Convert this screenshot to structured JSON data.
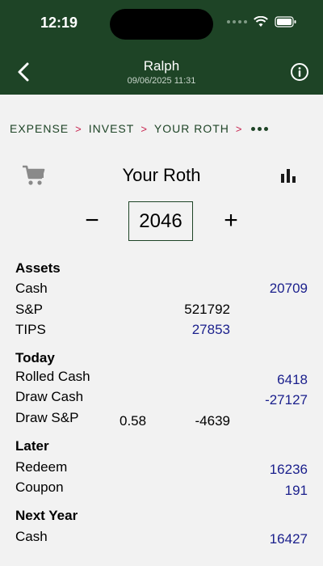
{
  "status_bar": {
    "time": "12:19"
  },
  "header": {
    "name": "Ralph",
    "timestamp": "09/06/2025 11:31"
  },
  "breadcrumb": {
    "items": [
      "EXPENSE",
      "INVEST",
      "YOUR ROTH"
    ],
    "separator": ">"
  },
  "page": {
    "title": "Your Roth",
    "year": "2046",
    "minus_label": "−",
    "plus_label": "+"
  },
  "sections": {
    "assets": {
      "heading": "Assets",
      "cash_label": "Cash",
      "cash_value": "20709",
      "sp_label": "S&P",
      "sp_value": "521792",
      "tips_label": "TIPS",
      "tips_value": "27853"
    },
    "today": {
      "heading": "Today",
      "rolled_label": "Rolled Cash",
      "rolled_value": "6418",
      "draw_cash_label": "Draw Cash",
      "draw_cash_value": "-27127",
      "draw_sp_label": "Draw S&P",
      "draw_sp_rate": "0.58",
      "draw_sp_value": "-4639"
    },
    "later": {
      "heading": "Later",
      "redeem_label": "Redeem",
      "redeem_value": "16236",
      "coupon_label": "Coupon",
      "coupon_value": "191"
    },
    "next_year": {
      "heading": "Next Year",
      "cash_label": "Cash",
      "cash_value": "16427"
    }
  },
  "icons": {
    "back": "chevron-left-icon",
    "info": "info-icon",
    "cart": "cart-icon",
    "chart": "bar-chart-icon",
    "more": "more-dots-icon"
  },
  "colors": {
    "header_bg": "#1e4426",
    "accent_green": "#1e4426",
    "separator_red": "#c8224e",
    "value_blue": "#1a1f8c",
    "background": "#f2f2f2"
  }
}
